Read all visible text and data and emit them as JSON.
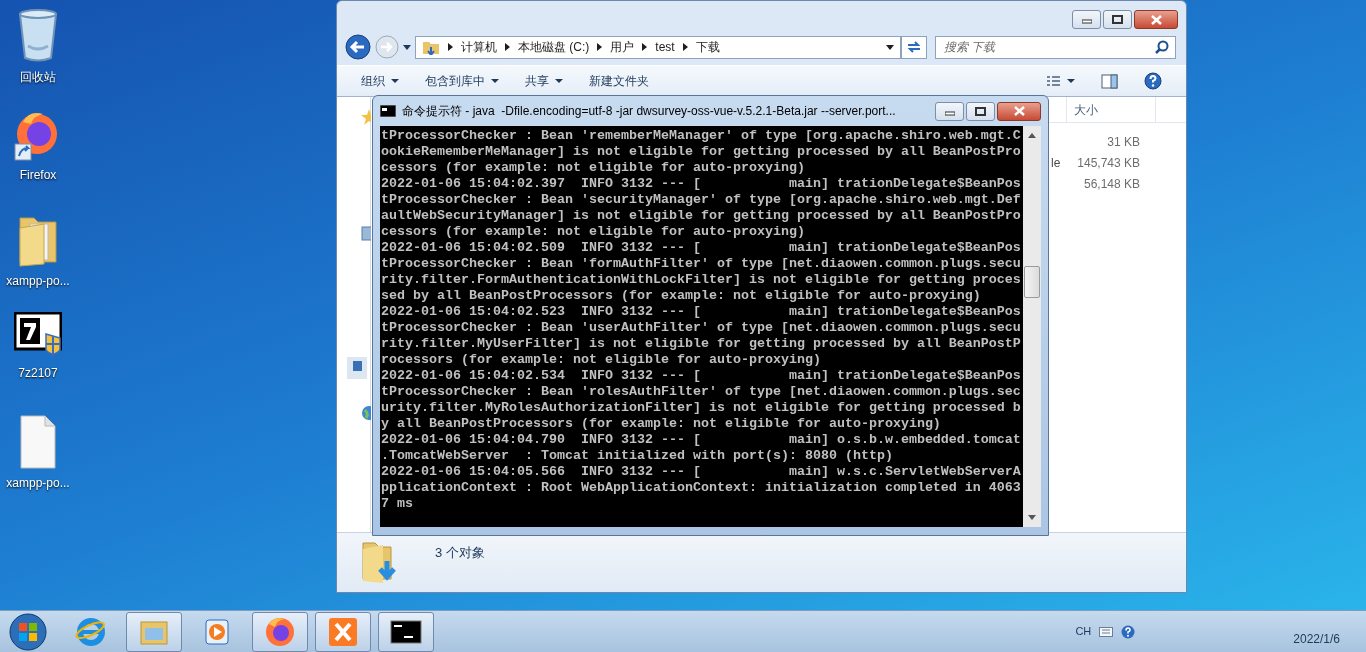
{
  "desktop_icons": [
    {
      "kind": "recycle-bin",
      "label": "回收站"
    },
    {
      "kind": "firefox",
      "label": "Firefox"
    },
    {
      "kind": "folder",
      "label": "xampp-po..."
    },
    {
      "kind": "installer",
      "label": "7z2107"
    },
    {
      "kind": "file",
      "label": "xampp-po..."
    }
  ],
  "explorer": {
    "breadcrumb": [
      "计算机",
      "本地磁盘 (C:)",
      "用户",
      "test",
      "下载"
    ],
    "search": {
      "placeholder": "搜索 下载"
    },
    "toolbar": [
      {
        "label": "组织",
        "dropdown": true
      },
      {
        "label": "包含到库中",
        "dropdown": true
      },
      {
        "label": "共享",
        "dropdown": true
      },
      {
        "label": "新建文件夹",
        "dropdown": false
      }
    ],
    "column_header": "大小",
    "rows": [
      {
        "size": "31 KB"
      },
      {
        "name": "le",
        "size": "145,743 KB"
      },
      {
        "size": "56,148 KB"
      }
    ],
    "status": "3 个对象"
  },
  "console": {
    "title": "命令提示符 - java  -Dfile.encoding=utf-8 -jar dwsurvey-oss-vue-v.5.2.1-Beta.jar --server.port...",
    "lines": [
      "tProcessorChecker : Bean 'rememberMeManager' of type [org.apache.shiro.web.mgt.C",
      "ookieRememberMeManager] is not eligible for getting processed by all BeanPostPro",
      "cessors (for example: not eligible for auto-proxying)",
      "2022-01-06 15:04:02.397  INFO 3132 --- [           main] trationDelegate$BeanPos",
      "tProcessorChecker : Bean 'securityManager' of type [org.apache.shiro.web.mgt.Def",
      "aultWebSecurityManager] is not eligible for getting processed by all BeanPostPro",
      "cessors (for example: not eligible for auto-proxying)",
      "2022-01-06 15:04:02.509  INFO 3132 --- [           main] trationDelegate$BeanPos",
      "tProcessorChecker : Bean 'formAuthFilter' of type [net.diaowen.common.plugs.secu",
      "rity.filter.FormAuthenticationWithLockFilter] is not eligible for getting proces",
      "sed by all BeanPostProcessors (for example: not eligible for auto-proxying)",
      "2022-01-06 15:04:02.523  INFO 3132 --- [           main] trationDelegate$BeanPos",
      "tProcessorChecker : Bean 'userAuthFilter' of type [net.diaowen.common.plugs.secu",
      "rity.filter.MyUserFilter] is not eligible for getting processed by all BeanPostP",
      "rocessors (for example: not eligible for auto-proxying)",
      "2022-01-06 15:04:02.534  INFO 3132 --- [           main] trationDelegate$BeanPos",
      "tProcessorChecker : Bean 'rolesAuthFilter' of type [net.diaowen.common.plugs.sec",
      "urity.filter.MyRolesAuthorizationFilter] is not eligible for getting processed b",
      "y all BeanPostProcessors (for example: not eligible for auto-proxying)",
      "2022-01-06 15:04:04.790  INFO 3132 --- [           main] o.s.b.w.embedded.tomcat",
      ".TomcatWebServer  : Tomcat initialized with port(s): 8080 (http)",
      "2022-01-06 15:04:05.566  INFO 3132 --- [           main] w.s.c.ServletWebServerA",
      "pplicationContext : Root WebApplicationContext: initialization completed in 4063",
      "7 ms"
    ]
  },
  "taskbar": {
    "apps": [
      {
        "kind": "ie",
        "running": false
      },
      {
        "kind": "explorer",
        "running": true
      },
      {
        "kind": "media",
        "running": false
      },
      {
        "kind": "firefox",
        "running": true
      },
      {
        "kind": "xampp",
        "running": true
      },
      {
        "kind": "console",
        "running": true
      }
    ],
    "language": "CH",
    "date": "2022/1/6"
  }
}
